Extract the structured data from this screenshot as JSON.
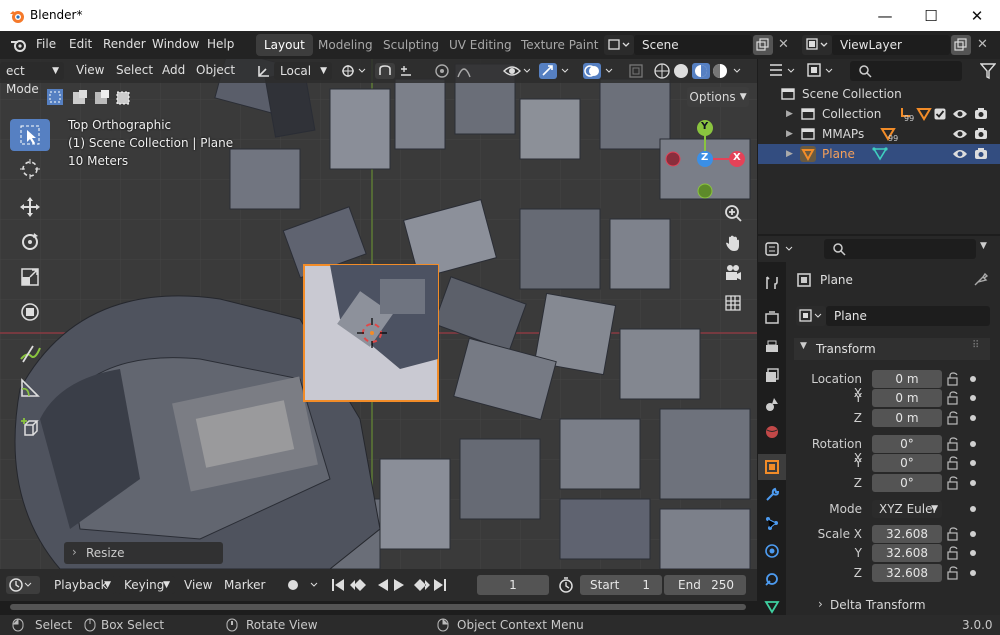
{
  "window": {
    "title": "Blender*",
    "minimize": "—",
    "maximize": "☐",
    "close": "✕"
  },
  "menu": [
    "File",
    "Edit",
    "Render",
    "Window",
    "Help"
  ],
  "workspaces": {
    "active": "Layout",
    "others": [
      "Modeling",
      "Sculpting",
      "UV Editing",
      "Texture Paint"
    ]
  },
  "scene": {
    "name": "Scene",
    "view_layer": "ViewLayer"
  },
  "viewport_header": {
    "mode": "ect Mode",
    "items": [
      "View",
      "Select",
      "Add",
      "Object"
    ],
    "orientation": "Local",
    "options": "Options"
  },
  "overlay": {
    "view_name": "Top Orthographic",
    "collection": "(1) Scene Collection | Plane",
    "scale": "10 Meters"
  },
  "gizmo": {
    "y": "Y",
    "z": "Z",
    "x": "X"
  },
  "last_op": "Resize",
  "timeline": {
    "playback": "Playback",
    "keying": "Keying",
    "view": "View",
    "marker": "Marker",
    "current_frame": "1",
    "start_label": "Start",
    "start": "1",
    "end_label": "End",
    "end": "250"
  },
  "status": {
    "select": "Select",
    "box_select": "Box Select",
    "rotate_view": "Rotate View",
    "context_menu": "Object Context Menu",
    "version": "3.0.0"
  },
  "outliner": {
    "scene_collection": "Scene Collection",
    "rows": [
      {
        "name": "Collection",
        "badge": "99"
      },
      {
        "name": "MMAPs",
        "badge": "99"
      },
      {
        "name": "Plane",
        "badge": ""
      }
    ]
  },
  "properties": {
    "object_name": "Plane",
    "data_name": "Plane",
    "transform_label": "Transform",
    "location": {
      "label": "Location X",
      "x": "0 m",
      "y": "0 m",
      "z": "0 m"
    },
    "rotation": {
      "label": "Rotation X",
      "x": "0°",
      "y": "0°",
      "z": "0°"
    },
    "mode_label": "Mode",
    "mode": "XYZ Euler",
    "scale": {
      "label": "Scale X",
      "x": "32.608",
      "y": "32.608",
      "z": "32.608"
    },
    "y_label": "Y",
    "z_label": "Z",
    "delta": "Delta Transform"
  },
  "colors": {
    "accent": "#5680c2",
    "selection": "#334d80",
    "orange": "#f28c28",
    "x_axis": "#e44258",
    "y_axis": "#8ac43f",
    "z_axis": "#3b8fe6"
  }
}
